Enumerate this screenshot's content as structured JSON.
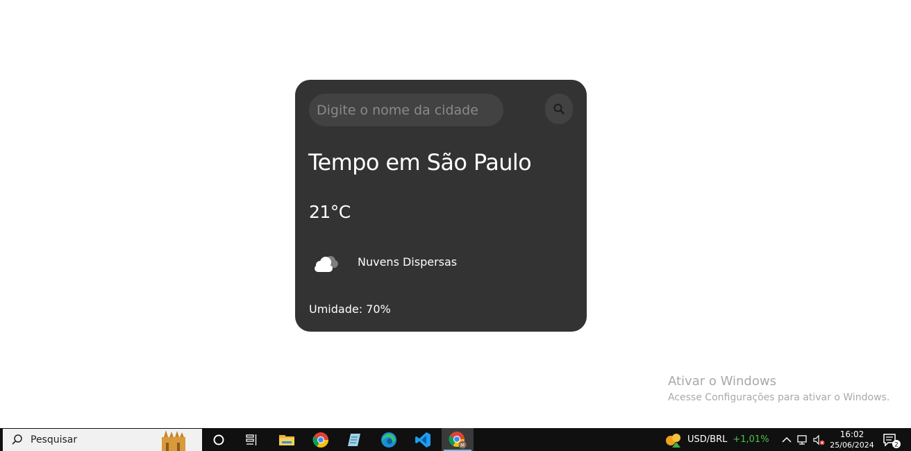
{
  "weather": {
    "search_placeholder": "Digite o nome da cidade",
    "search_value": "",
    "title": "Tempo em São Paulo",
    "temperature": "21°C",
    "description": "Nuvens Dispersas",
    "humidity": "Umidade: 70%",
    "icon": "scattered-clouds-icon"
  },
  "watermark": {
    "title": "Ativar o Windows",
    "subtitle": "Acesse Configurações para ativar o Windows."
  },
  "taskbar": {
    "search_label": "Pesquisar",
    "apps": [
      "cortana-icon",
      "task-view-icon",
      "file-explorer-icon",
      "chrome-icon",
      "notepad-icon",
      "edge-icon",
      "vscode-icon",
      "chrome-profile-icon"
    ],
    "ticker_label": "USD/BRL",
    "ticker_change": "+1,01%",
    "time": "16:02",
    "date": "25/06/2024",
    "notification_count": "2"
  },
  "colors": {
    "card_bg": "#333333",
    "input_bg": "#424242",
    "taskbar_bg": "#101010",
    "ticker_positive": "#4cc24c"
  }
}
